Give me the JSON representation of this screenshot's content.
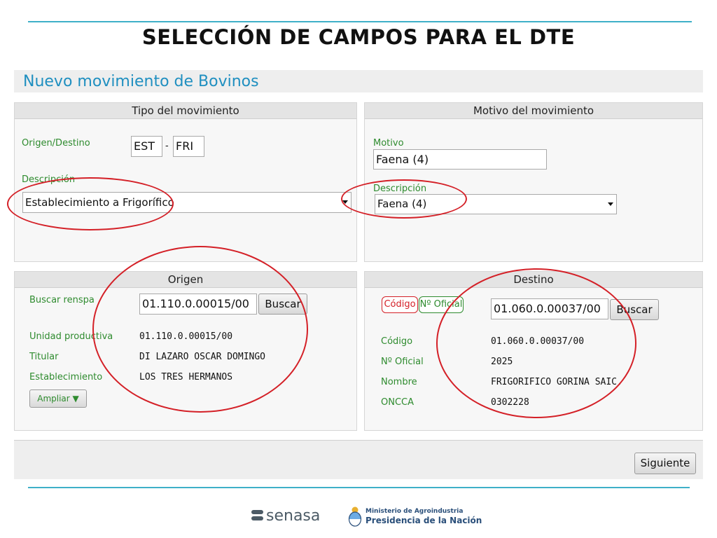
{
  "slide": {
    "title": "SELECCIÓN DE CAMPOS PARA EL DTE"
  },
  "app": {
    "header": "Nuevo movimiento de Bovinos"
  },
  "tipo": {
    "heading": "Tipo del movimiento",
    "origen_destino_label": "Origen/Destino",
    "origen_value": "EST",
    "separator": "-",
    "destino_value": "FRI",
    "descripcion_label": "Descripción",
    "descripcion_value": "Establecimiento a Frigorífico"
  },
  "motivo": {
    "heading": "Motivo del movimiento",
    "motivo_label": "Motivo",
    "motivo_value": "Faena (4)",
    "descripcion_label": "Descripción",
    "descripcion_value": "Faena (4)"
  },
  "origen": {
    "heading": "Origen",
    "buscar_label": "Buscar renspa",
    "renspa_value": "01.110.0.00015/00",
    "buscar_button": "Buscar",
    "unidad_label": "Unidad productiva",
    "unidad_value": "01.110.0.00015/00",
    "titular_label": "Titular",
    "titular_value": "DI LAZARO OSCAR DOMINGO",
    "establecimiento_label": "Establecimiento",
    "establecimiento_value": "LOS TRES HERMANOS",
    "ampliar_button": "Ampliar ▼"
  },
  "destino": {
    "heading": "Destino",
    "codigo_toggle": "Código",
    "oficial_toggle": "Nº Oficial",
    "search_value": "01.060.0.00037/00",
    "buscar_button": "Buscar",
    "codigo_label": "Código",
    "codigo_value": "01.060.0.00037/00",
    "oficial_label": "Nº Oficial",
    "oficial_value": "2025",
    "nombre_label": "Nombre",
    "nombre_value": "FRIGORIFICO GORINA SAIC.",
    "oncca_label": "ONCCA",
    "oncca_value": "0302228"
  },
  "footer": {
    "siguiente_button": "Siguiente"
  },
  "logos": {
    "senasa": "senasa",
    "ministerio_line1": "Ministerio de Agroindustria",
    "ministerio_line2": "Presidencia de la Nación"
  },
  "colors": {
    "accent_rule": "#3fb0c8",
    "header_text": "#1f8fc0",
    "label_green": "#2e8b2e",
    "annotation_red": "#d42027"
  }
}
